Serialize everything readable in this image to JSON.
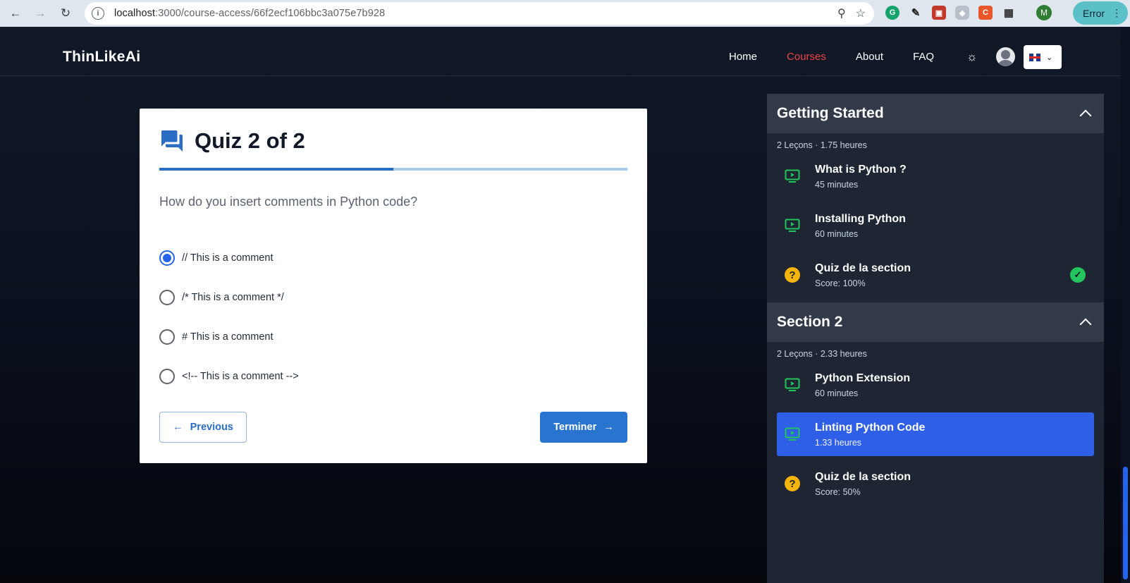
{
  "browser": {
    "url_host": "localhost",
    "url_path": ":3000/course-access/66f2ecf106bbc3a075e7b928",
    "profile_initial": "M",
    "error_label": "Error"
  },
  "nav": {
    "brand": "ThinLikeAi",
    "links": [
      {
        "label": "Home",
        "active": false
      },
      {
        "label": "Courses",
        "active": true
      },
      {
        "label": "About",
        "active": false
      },
      {
        "label": "FAQ",
        "active": false
      }
    ]
  },
  "quiz": {
    "title": "Quiz 2 of 2",
    "progress_fraction": 0.5,
    "question": "How do you insert comments in Python code?",
    "options": [
      {
        "label": "// This is a comment",
        "selected": true
      },
      {
        "label": "/* This is a comment */",
        "selected": false
      },
      {
        "label": "# This is a comment",
        "selected": false
      },
      {
        "label": "<!-- This is a comment -->",
        "selected": false
      }
    ],
    "prev_label": "Previous",
    "next_label": "Terminer"
  },
  "sidebar": {
    "sections": [
      {
        "title": "Getting Started",
        "meta": "2 Leçons · 1.75 heures",
        "items": [
          {
            "type": "video",
            "title": "What is Python ?",
            "sub": "45 minutes",
            "active": false,
            "done": false
          },
          {
            "type": "video",
            "title": "Installing Python",
            "sub": "60 minutes",
            "active": false,
            "done": false
          },
          {
            "type": "quiz",
            "title": "Quiz de la section",
            "sub": "Score: 100%",
            "active": false,
            "done": true
          }
        ]
      },
      {
        "title": "Section 2",
        "meta": "2 Leçons · 2.33 heures",
        "items": [
          {
            "type": "video",
            "title": "Python Extension",
            "sub": "60 minutes",
            "active": false,
            "done": false
          },
          {
            "type": "video",
            "title": "Linting Python Code",
            "sub": "1.33 heures",
            "active": true,
            "done": false
          },
          {
            "type": "quiz",
            "title": "Quiz de la section",
            "sub": "Score: 50%",
            "active": false,
            "done": false
          }
        ]
      }
    ]
  },
  "colors": {
    "accent": "#2874cf",
    "active_nav": "#ef4444",
    "active_lesson": "#2f5fe6",
    "done": "#22c55e",
    "quiz_icon": "#f5b50a"
  }
}
